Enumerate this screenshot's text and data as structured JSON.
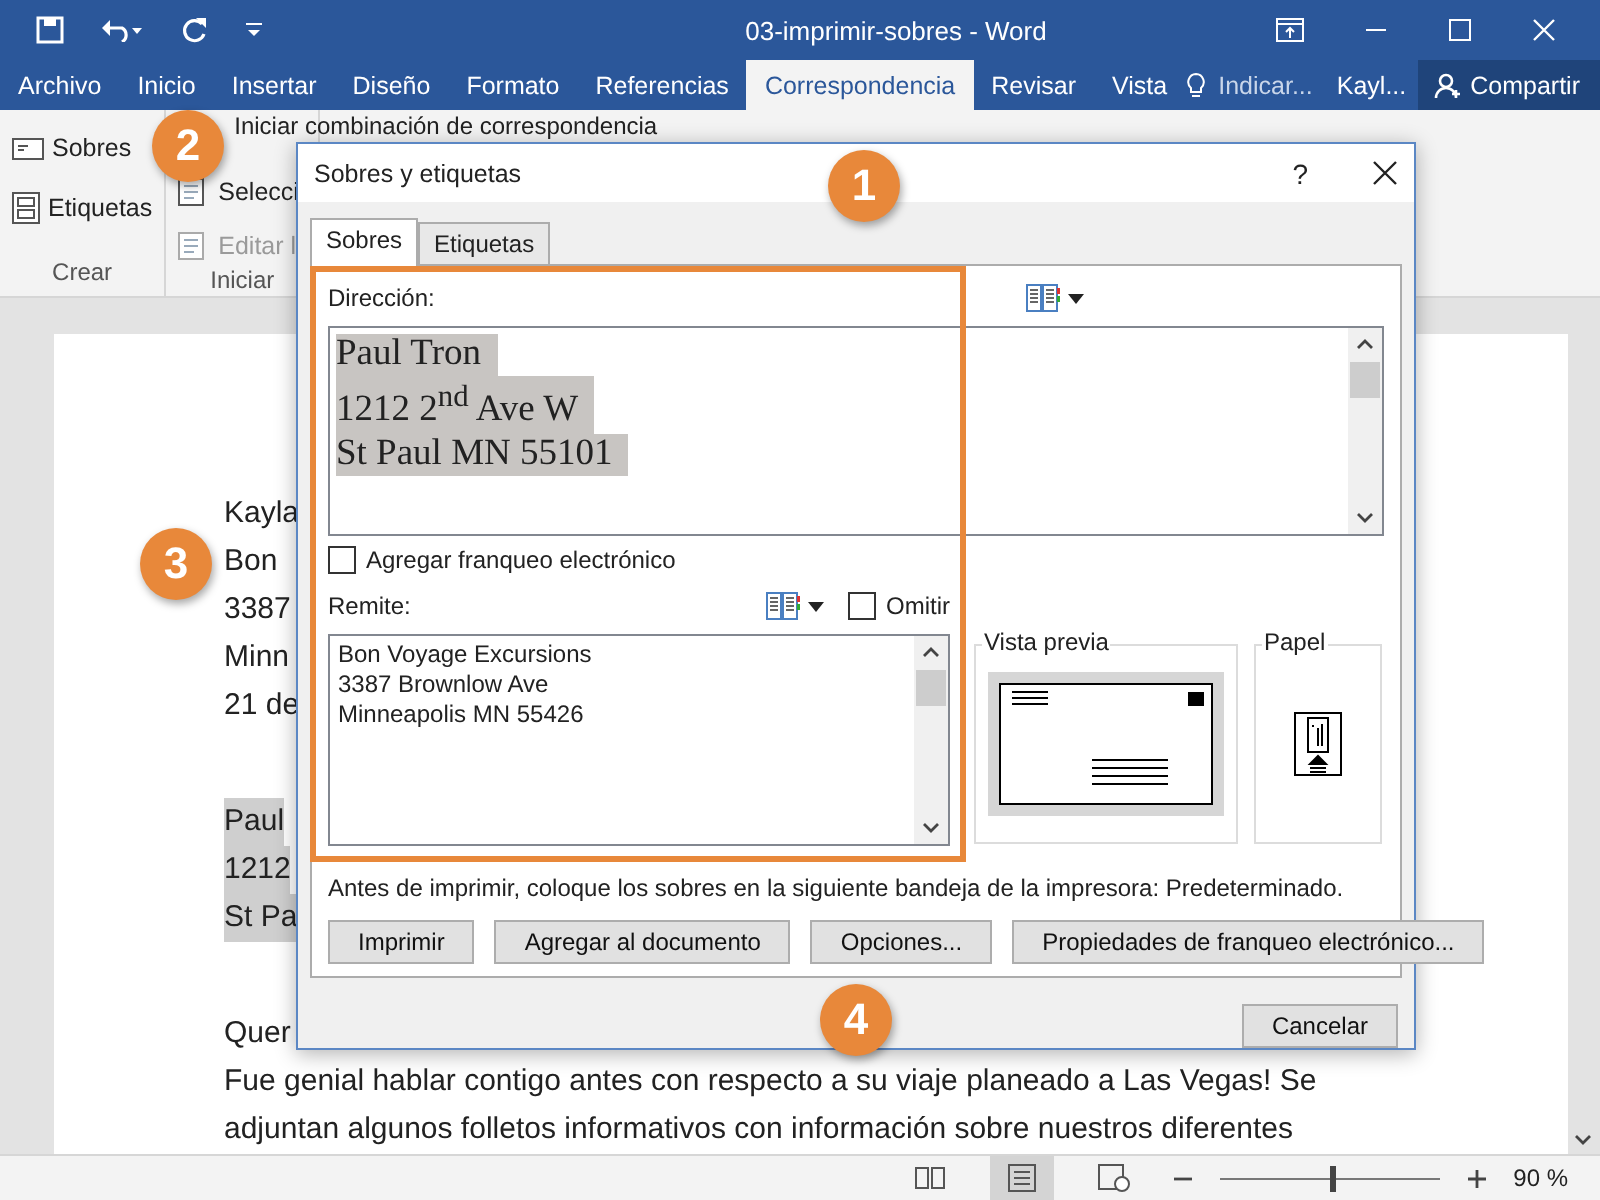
{
  "window": {
    "title": "03-imprimir-sobres  -  Word"
  },
  "tabs": [
    {
      "label": "Archivo",
      "selected": false
    },
    {
      "label": "Inicio",
      "selected": false
    },
    {
      "label": "Insertar",
      "selected": false
    },
    {
      "label": "Diseño",
      "selected": false
    },
    {
      "label": "Formato",
      "selected": false
    },
    {
      "label": "Referencias",
      "selected": false
    },
    {
      "label": "Correspondencia",
      "selected": true
    },
    {
      "label": "Revisar",
      "selected": false
    },
    {
      "label": "Vista",
      "selected": false
    }
  ],
  "tell_me": "Indicar...",
  "user": "Kayl...",
  "share": "Compartir",
  "ribbon": {
    "groups": [
      {
        "label": "Crear",
        "items": [
          {
            "label": "Sobres",
            "disabled": false
          },
          {
            "label": "Etiquetas",
            "disabled": false
          }
        ]
      },
      {
        "label": "Iniciar",
        "items": [
          {
            "label": "Iniciar combinación de correspondencia",
            "disabled": false
          },
          {
            "label": "Selecci",
            "disabled": false
          },
          {
            "label": "Editar l",
            "disabled": true
          }
        ]
      }
    ]
  },
  "document": {
    "lines": [
      {
        "text": "Kayla",
        "highlighted": false
      },
      {
        "text": "Bon",
        "highlighted": false
      },
      {
        "text": "3387",
        "highlighted": false
      },
      {
        "text": "Minn",
        "highlighted": false
      },
      {
        "text": "21 de",
        "highlighted": false
      },
      {
        "text": "Paul",
        "highlighted": true
      },
      {
        "text": "1212",
        "highlighted": true
      },
      {
        "text": "St Pa",
        "highlighted": true
      },
      {
        "text": "Quer",
        "highlighted": false
      }
    ],
    "paragraph": [
      "Fue genial hablar contigo antes con respecto a su viaje planeado a Las Vegas! Se",
      "adjuntan algunos folletos informativos con información sobre nuestros diferentes"
    ]
  },
  "dialog": {
    "title": "Sobres y etiquetas",
    "help": "?",
    "tabs": [
      {
        "label": "Sobres",
        "selected": true
      },
      {
        "label": "Etiquetas",
        "selected": false
      }
    ],
    "address": {
      "label": "Dirección:",
      "lines": [
        "Paul Tron",
        "1212 2$^{nd}$ Ave W",
        "St Paul MN 55101"
      ]
    },
    "electronic_postage": {
      "label": "Agregar franqueo electrónico",
      "checked": false
    },
    "return_address": {
      "label": "Remite:",
      "omit": {
        "label": "Omitir",
        "checked": false
      },
      "lines": [
        "Bon Voyage Excursions",
        "3387 Brownlow Ave",
        "Minneapolis MN 55426"
      ]
    },
    "preview": {
      "label": "Vista previa"
    },
    "paper": {
      "label": "Papel"
    },
    "note": "Antes de imprimir, coloque los sobres en la siguiente bandeja de la impresora: Predeterminado.",
    "buttons": [
      "Imprimir",
      "Agregar al documento",
      "Opciones...",
      "Propiedades de franqueo electrónico..."
    ],
    "cancel": "Cancelar"
  },
  "callouts": [
    {
      "number": "1"
    },
    {
      "number": "2"
    },
    {
      "number": "3"
    },
    {
      "number": "4"
    }
  ],
  "status_bar": {
    "zoom": {
      "level": 0.5,
      "reading": "90 %"
    }
  }
}
